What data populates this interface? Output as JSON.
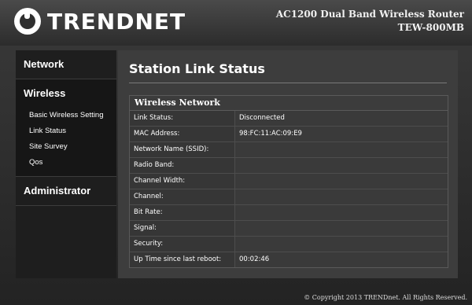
{
  "header": {
    "logo_text": "TRENDNET",
    "product_line1": "AC1200 Dual Band Wireless Router",
    "product_line2": "TEW-800MB"
  },
  "sidebar": {
    "network": "Network",
    "wireless": "Wireless",
    "wireless_items": [
      {
        "label": "Basic Wireless Setting"
      },
      {
        "label": "Link Status"
      },
      {
        "label": "Site Survey"
      },
      {
        "label": "Qos"
      }
    ],
    "administrator": "Administrator"
  },
  "main": {
    "page_title": "Station Link Status",
    "table_title": "Wireless Network",
    "rows": [
      {
        "label": "Link Status:",
        "value": "Disconnected"
      },
      {
        "label": "MAC Address:",
        "value": "98:FC:11:AC:09:E9"
      },
      {
        "label": "Network Name (SSID):",
        "value": ""
      },
      {
        "label": "Radio Band:",
        "value": ""
      },
      {
        "label": "Channel Width:",
        "value": ""
      },
      {
        "label": "Channel:",
        "value": ""
      },
      {
        "label": "Bit Rate:",
        "value": ""
      },
      {
        "label": "Signal:",
        "value": ""
      },
      {
        "label": "Security:",
        "value": ""
      },
      {
        "label": "Up Time since last reboot:",
        "value": "00:02:46"
      }
    ]
  },
  "footer": {
    "copyright": "© Copyright 2013 TRENDnet. All Rights Reserved."
  }
}
